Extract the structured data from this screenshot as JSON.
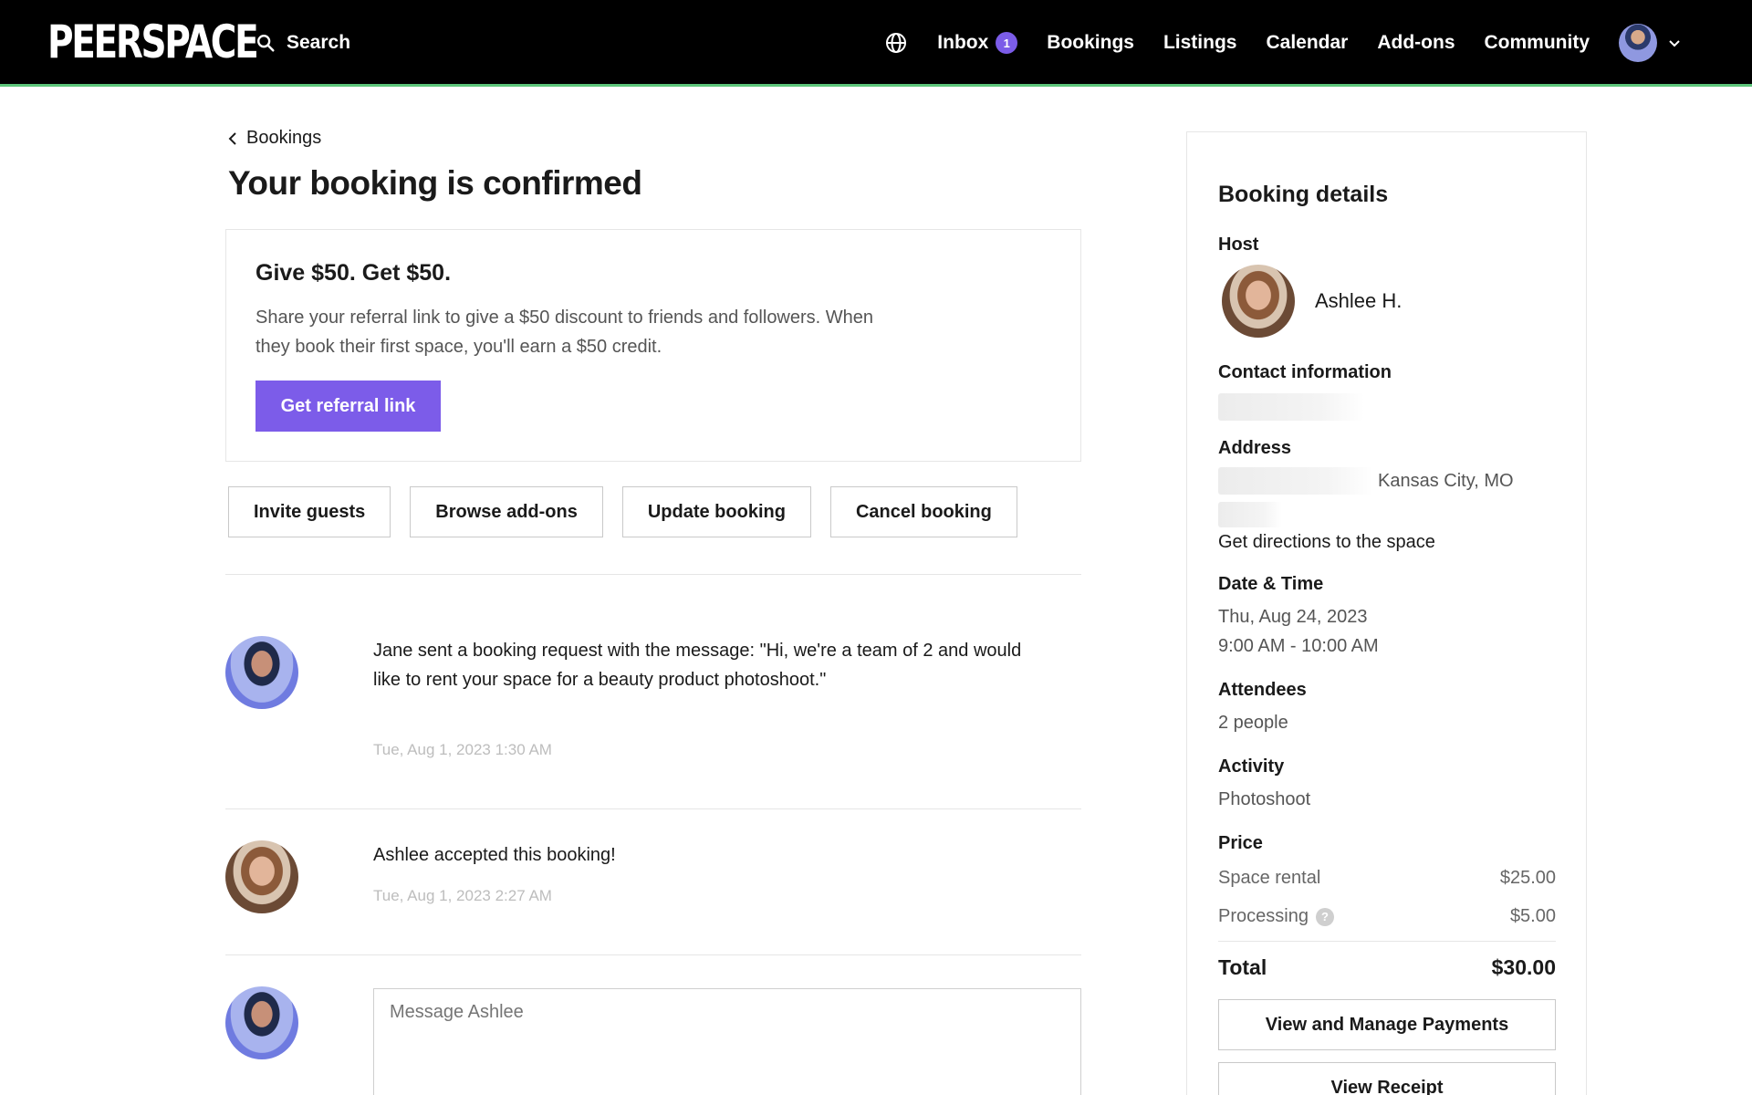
{
  "nav": {
    "logo": "PEERSPACE",
    "search_label": "Search",
    "inbox_label": "Inbox",
    "inbox_count": "1",
    "bookings_label": "Bookings",
    "listings_label": "Listings",
    "calendar_label": "Calendar",
    "addons_label": "Add-ons",
    "community_label": "Community"
  },
  "breadcrumb": {
    "back_label": "Bookings"
  },
  "page": {
    "title": "Your booking is confirmed"
  },
  "promo": {
    "heading": "Give $50. Get $50.",
    "body": "Share your referral link to give a $50 discount to friends and followers. When they book their first space, you'll earn a $50 credit.",
    "cta_label": "Get referral link"
  },
  "actions": {
    "invite": "Invite guests",
    "browse_addons": "Browse add-ons",
    "update": "Update booking",
    "cancel": "Cancel booking"
  },
  "messages": [
    {
      "text": "Jane sent a booking request with the message: \"Hi, we're a team of 2 and would like to rent your space for a beauty product photoshoot.\"",
      "time": "Tue, Aug 1, 2023 1:30 AM"
    },
    {
      "text": "Ashlee accepted this booking!",
      "time": "Tue, Aug 1, 2023 2:27 AM"
    }
  ],
  "composer": {
    "placeholder": "Message Ashlee"
  },
  "details": {
    "title": "Booking details",
    "host_heading": "Host",
    "host_name": "Ashlee H.",
    "contact_heading": "Contact information",
    "address_heading": "Address",
    "address_city": "Kansas City, MO",
    "directions_label": "Get directions to the space",
    "datetime_heading": "Date & Time",
    "date": "Thu, Aug 24, 2023",
    "time": "9:00 AM - 10:00 AM",
    "attendees_heading": "Attendees",
    "attendees": "2 people",
    "activity_heading": "Activity",
    "activity": "Photoshoot",
    "price_heading": "Price",
    "space_rental_label": "Space rental",
    "space_rental_value": "$25.00",
    "processing_label": "Processing",
    "processing_value": "$5.00",
    "help_glyph": "?",
    "total_label": "Total",
    "total_value": "$30.00",
    "manage_payments_label": "View and Manage Payments",
    "receipt_label": "View Receipt"
  },
  "colors": {
    "accent": "#7c5ce9",
    "nav_bg": "#000000",
    "nav_underline": "#5cc57a"
  }
}
